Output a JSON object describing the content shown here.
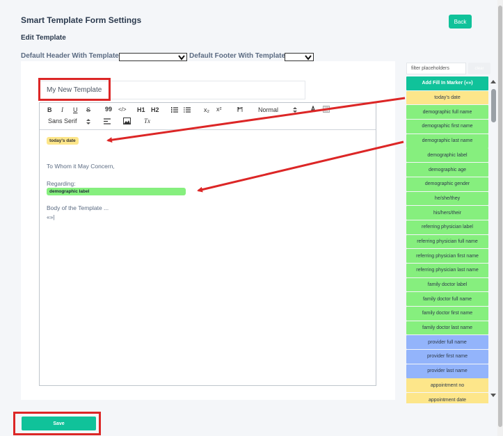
{
  "header": {
    "title": "Smart Template Form Settings",
    "back_label": "Back",
    "subtitle": "Edit Template"
  },
  "defaults": {
    "header_label": "Default Header With Template",
    "footer_label": "Default Footer With Template"
  },
  "template": {
    "name": "My New Template"
  },
  "toolbar": {
    "bold": "B",
    "italic": "I",
    "underline": "U",
    "strike": "S",
    "quote": "99",
    "code": "</>",
    "h1": "H1",
    "h2": "H2",
    "sub": "x₂",
    "sup": "x²",
    "rtl": "⁋¶",
    "size": "Normal",
    "font": "Sans Serif",
    "clear": "Tx"
  },
  "content": {
    "date_chip": "today's date",
    "greeting": "To Whom it May Concern,",
    "regarding": "Regarding:",
    "label_chip": "demographic label",
    "body": "Body of the Template ...",
    "marker": "«»|"
  },
  "sidebar": {
    "filter_placeholder": "filter placeholders",
    "clear_label": "clear",
    "add_label": "Add Fill In Marker («»)",
    "items": [
      {
        "label": "today's date",
        "color": "yellow"
      },
      {
        "label": "demographic full name",
        "color": "green"
      },
      {
        "label": "demographic first name",
        "color": "green"
      },
      {
        "label": "demographic last name",
        "color": "green"
      },
      {
        "label": "demographic label",
        "color": "green"
      },
      {
        "label": "demographic age",
        "color": "green"
      },
      {
        "label": "demographic gender",
        "color": "green"
      },
      {
        "label": "he/she/they",
        "color": "green"
      },
      {
        "label": "his/hers/their",
        "color": "green"
      },
      {
        "label": "referring physician label",
        "color": "green"
      },
      {
        "label": "referring physician full name",
        "color": "green"
      },
      {
        "label": "referring physician first name",
        "color": "green"
      },
      {
        "label": "referring physician last name",
        "color": "green"
      },
      {
        "label": "family doctor label",
        "color": "green"
      },
      {
        "label": "family doctor full name",
        "color": "green"
      },
      {
        "label": "family doctor first name",
        "color": "green"
      },
      {
        "label": "family doctor last name",
        "color": "green"
      },
      {
        "label": "provider full name",
        "color": "blue"
      },
      {
        "label": "provider first name",
        "color": "blue"
      },
      {
        "label": "provider last name",
        "color": "blue"
      },
      {
        "label": "appointment no",
        "color": "yellow"
      },
      {
        "label": "appointment date",
        "color": "yellow"
      }
    ]
  },
  "footer": {
    "save_label": "Save"
  },
  "colors": {
    "accent": "#10c29a",
    "highlight_red": "#dc2626",
    "chip_yellow": "#fde68a",
    "chip_green": "#86ef7e",
    "chip_blue": "#93b4fb"
  }
}
